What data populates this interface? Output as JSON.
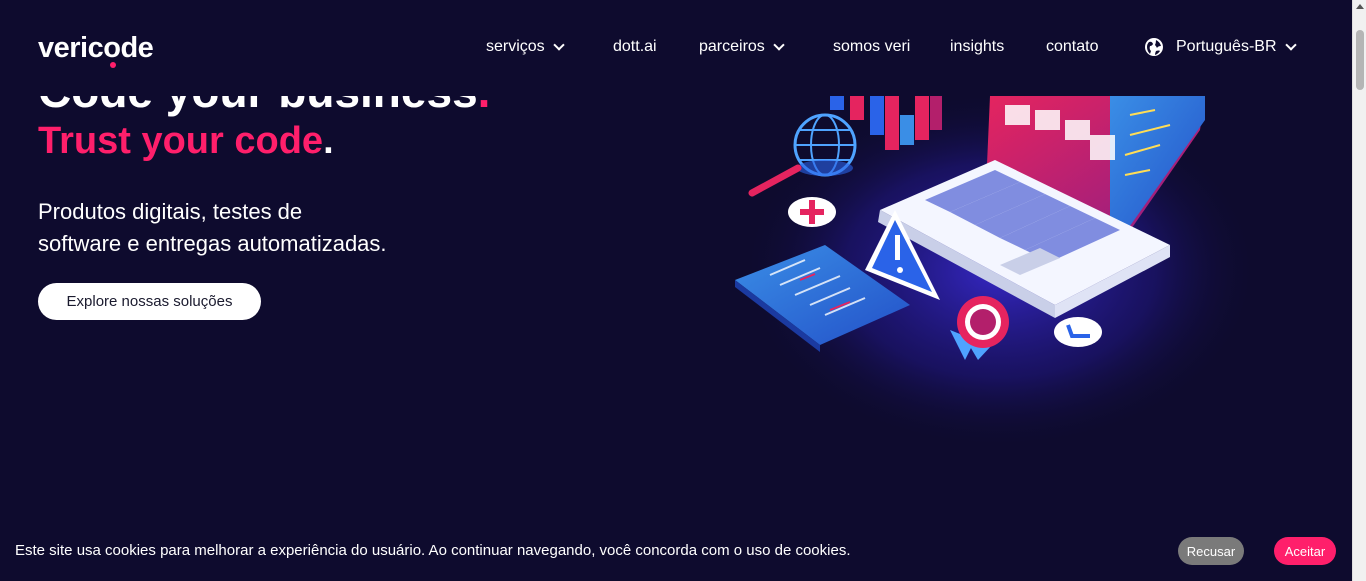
{
  "header": {
    "logo_prefix": "veric",
    "logo_o": "o",
    "logo_suffix": "de",
    "nav": [
      {
        "label": "serviços",
        "dropdown": true
      },
      {
        "label": "dott.ai",
        "dropdown": false
      },
      {
        "label": "parceiros",
        "dropdown": true
      },
      {
        "label": "somos veri",
        "dropdown": false
      },
      {
        "label": "insights",
        "dropdown": false
      },
      {
        "label": "contato",
        "dropdown": false
      }
    ],
    "language": {
      "label": "Português-BR",
      "icon": "globe-icon"
    }
  },
  "hero": {
    "headline_partial": "Code your business",
    "headline_period": ".",
    "line2": "Trust your code",
    "line2_period": ".",
    "subtitle_line1": "Produtos digitais, testes de",
    "subtitle_line2": "software e entregas automatizadas.",
    "cta_label": "Explore nossas soluções"
  },
  "cookie_bar": {
    "text": "Este site usa cookies para melhorar a experiência do usuário. Ao continuar navegando, você concorda com o uso de cookies.",
    "decline_label": "Recusar",
    "accept_label": "Aceitar"
  },
  "colors": {
    "background": "#0e0b2e",
    "accent": "#ff1f6b",
    "decline_button": "#7a7a7a"
  }
}
